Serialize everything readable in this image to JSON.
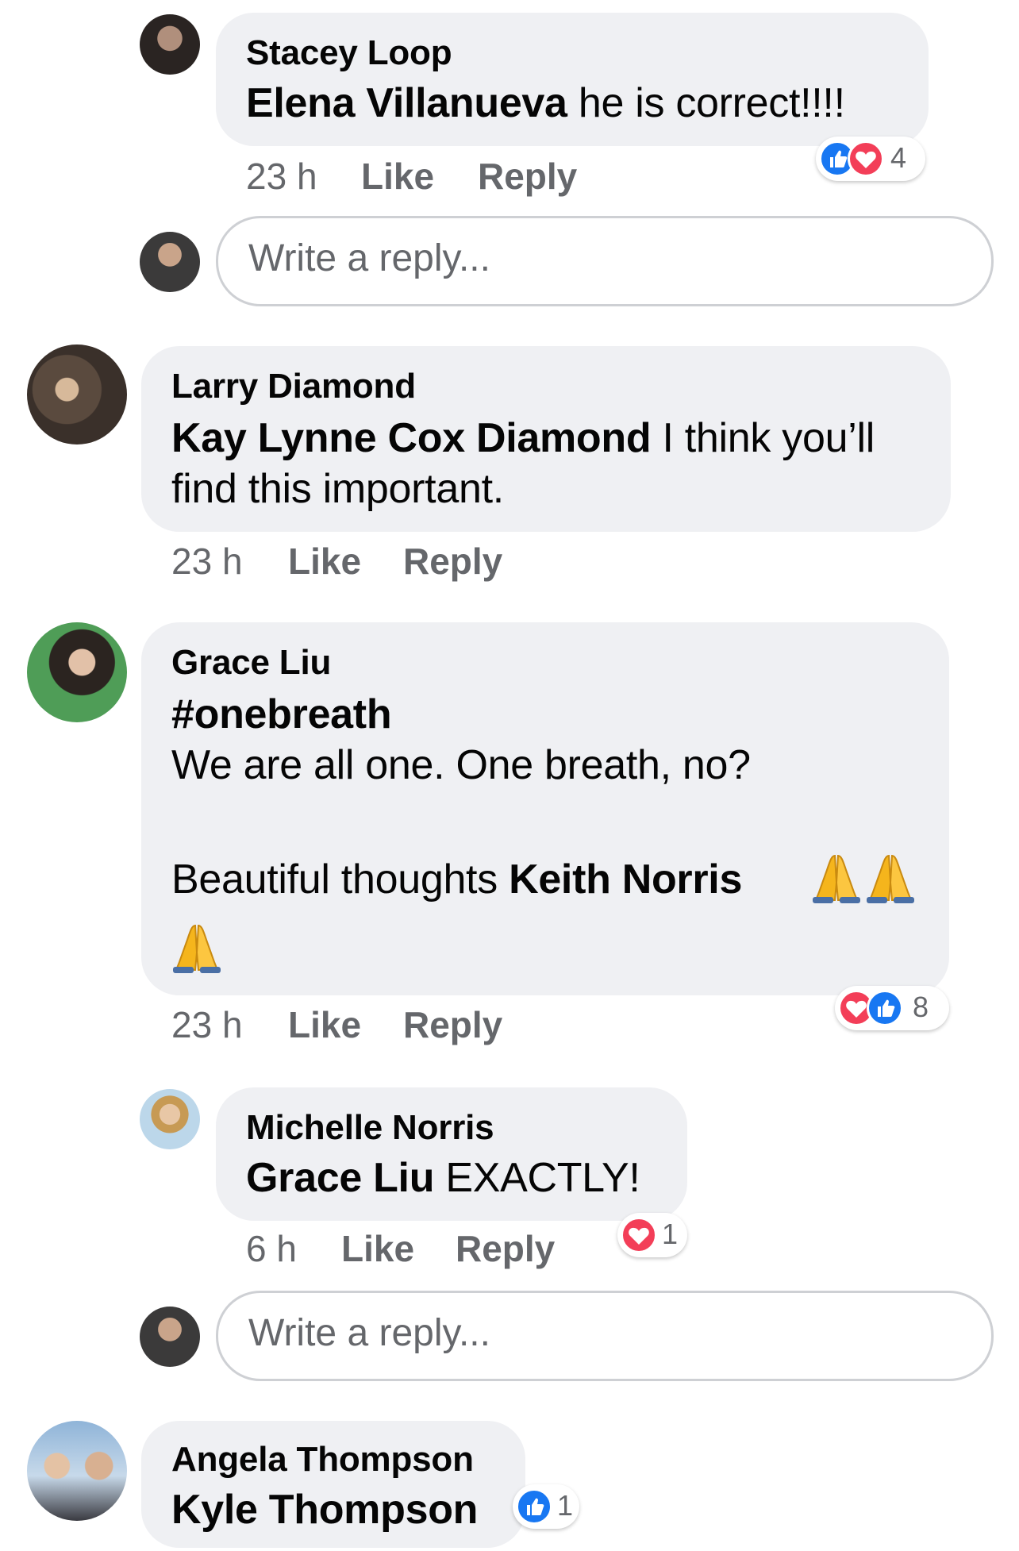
{
  "comments": [
    {
      "author": "Stacey Loop",
      "mention": "Elena Villanueva",
      "text": " he is correct!!!!",
      "time": "23 h",
      "like": "Like",
      "reply": "Reply",
      "reactions": {
        "types": [
          "like-icon",
          "love-icon"
        ],
        "count": "4"
      }
    },
    {
      "author": "Larry Diamond",
      "mention": "Kay Lynne Cox Diamond",
      "text_line1": " I think you’ll",
      "text_line2": "find this important.",
      "time": "23 h",
      "like": "Like",
      "reply": "Reply"
    },
    {
      "author": "Grace Liu",
      "hashtag": "#onebreath",
      "line2": "We are all one. One breath, no?",
      "line3_prefix": "Beautiful thoughts ",
      "mention": "Keith Norris",
      "emoji": [
        "folded-hands",
        "folded-hands",
        "folded-hands"
      ],
      "time": "23 h",
      "like": "Like",
      "reply": "Reply",
      "reactions": {
        "types": [
          "love-icon",
          "like-icon"
        ],
        "count": "8"
      }
    },
    {
      "author": "Michelle Norris",
      "mention": "Grace Liu",
      "text": " EXACTLY!",
      "time": "6 h",
      "like": "Like",
      "reply": "Reply",
      "reactions": {
        "types": [
          "love-icon"
        ],
        "count": "1"
      }
    },
    {
      "author": "Angela Thompson",
      "mention": "Kyle Thompson",
      "reactions": {
        "types": [
          "like-icon"
        ],
        "count": "1"
      }
    }
  ],
  "reply_input": {
    "placeholder": "Write a reply..."
  },
  "colors": {
    "bubble": "#eff0f3",
    "meta_text": "#65676b",
    "like_blue": "#1877f2",
    "love_red": "#f33e58"
  }
}
